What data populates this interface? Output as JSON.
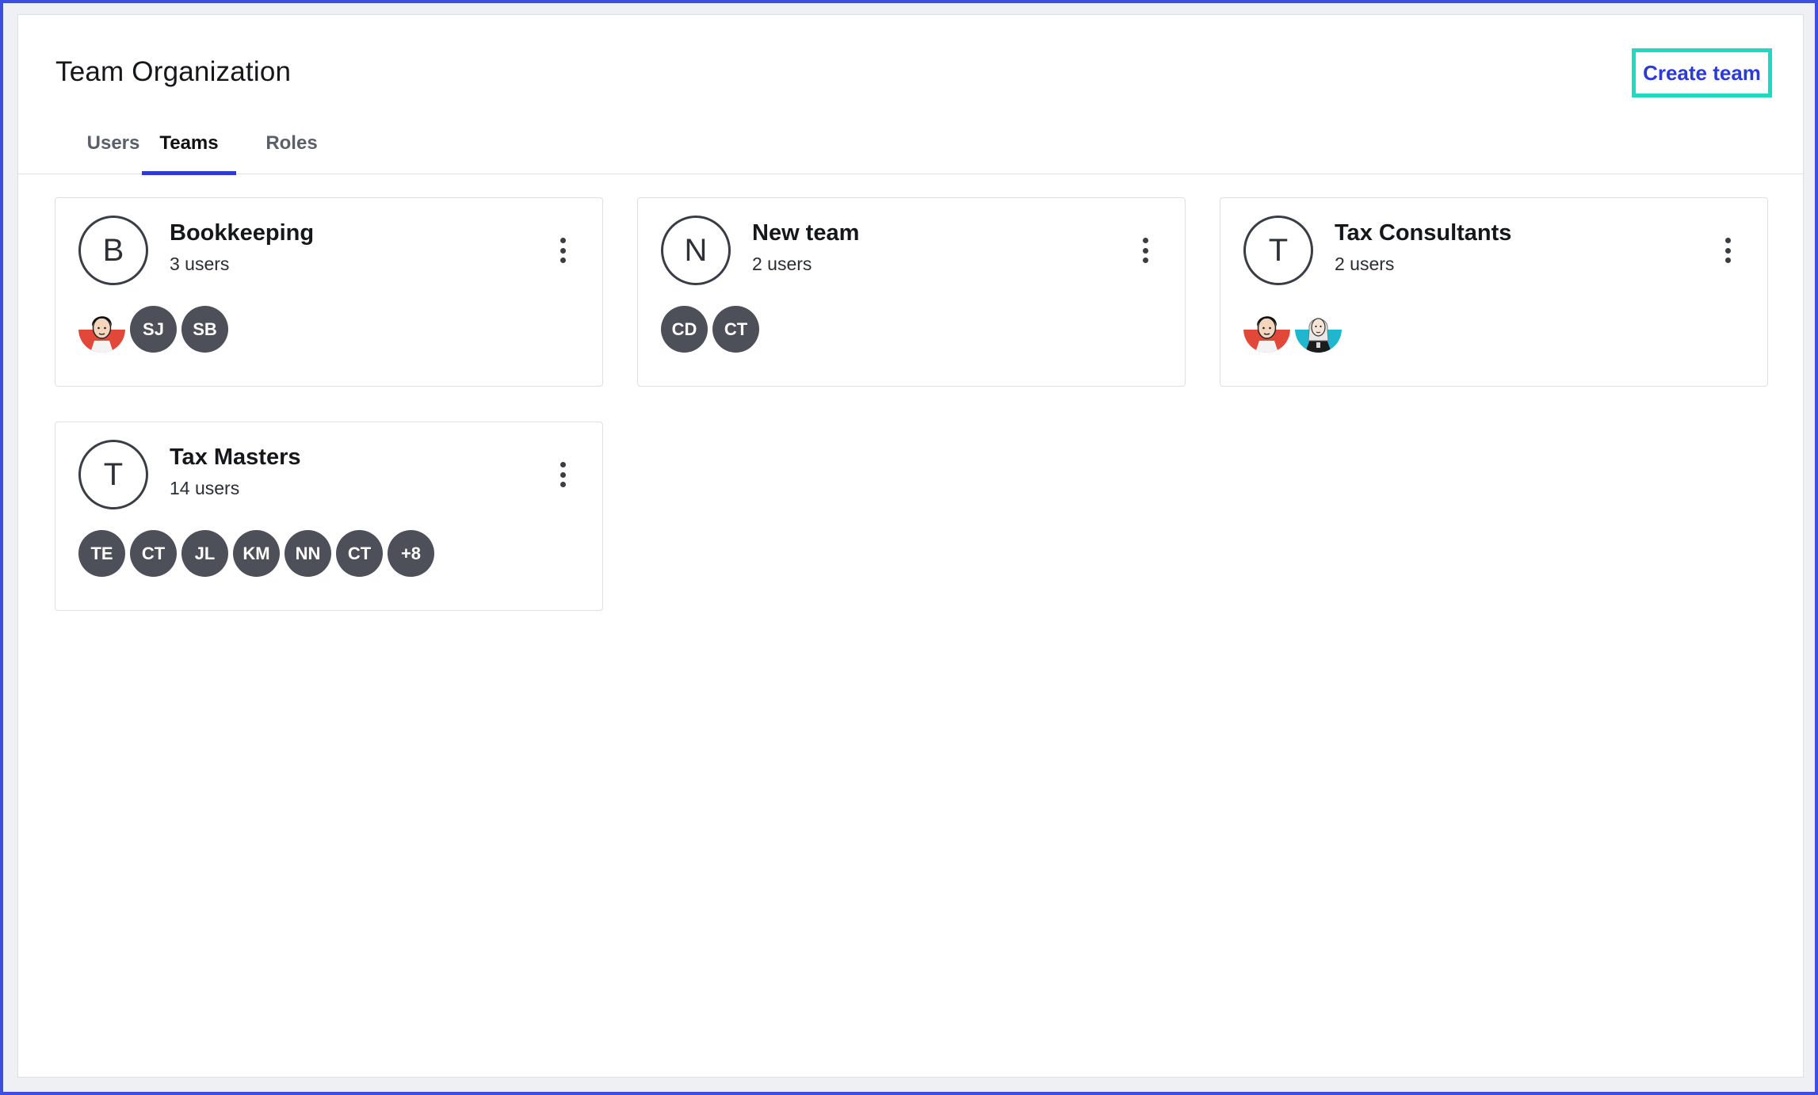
{
  "header": {
    "title": "Team Organization",
    "create_button": "Create team"
  },
  "tabs": [
    {
      "label": "Users",
      "active": false
    },
    {
      "label": "Teams",
      "active": true
    },
    {
      "label": "Roles",
      "active": false
    }
  ],
  "colors": {
    "accent": "#2b3ad8",
    "focus_outline": "#1fd9c0",
    "member_bg": "#4d5058"
  },
  "teams": [
    {
      "initial": "B",
      "name": "Bookkeeping",
      "count": "3 users",
      "members": [
        {
          "type": "photo",
          "icon": "man-portrait-icon"
        },
        {
          "type": "initials",
          "label": "SJ"
        },
        {
          "type": "initials",
          "label": "SB"
        }
      ]
    },
    {
      "initial": "N",
      "name": "New team",
      "count": "2 users",
      "members": [
        {
          "type": "initials",
          "label": "CD"
        },
        {
          "type": "initials",
          "label": "CT"
        }
      ]
    },
    {
      "initial": "T",
      "name": "Tax Consultants",
      "count": "2 users",
      "members": [
        {
          "type": "photo",
          "icon": "man-portrait-icon"
        },
        {
          "type": "photo",
          "icon": "woman-portrait-icon"
        }
      ]
    },
    {
      "initial": "T",
      "name": "Tax Masters",
      "count": "14 users",
      "members": [
        {
          "type": "initials",
          "label": "TE"
        },
        {
          "type": "initials",
          "label": "CT"
        },
        {
          "type": "initials",
          "label": "JL"
        },
        {
          "type": "initials",
          "label": "KM"
        },
        {
          "type": "initials",
          "label": "NN"
        },
        {
          "type": "initials",
          "label": "CT"
        },
        {
          "type": "initials",
          "label": "+8"
        }
      ]
    }
  ]
}
